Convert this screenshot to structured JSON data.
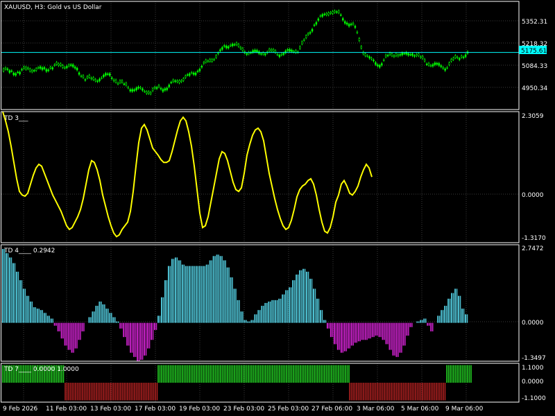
{
  "chart_data": [
    {
      "type": "candlestick",
      "title": "XAUUSD, H3:  Gold vs US Dollar",
      "yticks": [
        "5352.31",
        "5218.32",
        "5084.33",
        "4950.34"
      ],
      "current_price": "5175.61",
      "ylim": [
        4880,
        5440
      ],
      "close_approx": [
        5080,
        5075,
        5090,
        5085,
        5095,
        5100,
        5105,
        5110,
        5090,
        5040,
        5030,
        5050,
        5060,
        5020,
        5000,
        4990,
        4980,
        4970,
        4990,
        5000,
        5020,
        5040,
        5060,
        5100,
        5120,
        5160,
        5200,
        5230,
        5185,
        5180,
        5175,
        5180,
        5170,
        5175,
        5180,
        5190,
        5240,
        5330,
        5360,
        5390,
        5370,
        5340,
        5300,
        5180,
        5130,
        5120,
        5150,
        5170,
        5160,
        5180,
        5140,
        5120,
        5110,
        5100,
        5130,
        5160,
        5175
      ],
      "colors": {
        "up": "#00ff00",
        "price_line": "#00ffff"
      }
    },
    {
      "type": "line",
      "title": "TD 3___",
      "yticks": [
        "2.3059",
        "0.0000",
        "-1.3170"
      ],
      "ylim": [
        -1.317,
        2.3059
      ],
      "x": [
        0,
        4,
        8,
        12,
        16,
        20,
        24,
        28,
        32,
        36,
        40,
        44,
        48,
        52,
        56,
        60,
        64,
        68,
        72,
        76,
        80,
        84,
        88,
        92,
        96,
        100,
        104,
        108,
        112,
        116,
        120,
        124,
        128,
        132,
        136,
        140,
        144,
        148,
        152,
        156,
        160,
        164,
        168,
        172,
        176,
        180,
        184,
        188,
        192,
        196,
        200,
        204,
        208,
        212,
        216,
        220,
        224,
        228,
        232,
        236,
        240,
        244,
        248,
        252,
        256,
        260,
        264,
        268,
        272,
        276,
        280,
        284,
        288,
        292,
        296,
        300,
        304,
        308,
        312,
        316,
        320,
        324,
        328,
        332,
        336,
        340,
        344,
        348,
        352,
        356,
        360,
        364,
        368,
        372,
        376,
        380,
        384,
        388,
        392,
        396,
        400,
        404,
        408,
        412,
        416,
        420,
        424,
        428,
        432,
        436,
        440,
        444,
        448,
        452,
        456,
        460,
        464,
        468,
        472,
        476,
        480,
        484,
        488,
        492,
        496,
        500,
        504,
        508,
        512,
        516,
        520,
        524,
        528,
        532,
        536,
        540,
        544,
        548,
        552,
        556,
        560,
        564,
        568,
        572,
        576,
        580,
        584,
        588,
        592,
        596,
        600,
        604,
        608,
        612,
        616,
        620,
        624,
        628,
        632,
        636,
        640,
        644,
        648,
        652,
        656,
        660,
        664,
        668,
        672,
        674
      ],
      "y": [
        2.3,
        2.05,
        1.75,
        1.35,
        0.9,
        0.45,
        0.1,
        0.0,
        -0.03,
        0.05,
        0.3,
        0.55,
        0.75,
        0.85,
        0.8,
        0.6,
        0.4,
        0.2,
        0.0,
        -0.15,
        -0.3,
        -0.45,
        -0.65,
        -0.85,
        -0.95,
        -0.9,
        -0.75,
        -0.6,
        -0.4,
        -0.1,
        0.3,
        0.7,
        0.95,
        0.9,
        0.7,
        0.4,
        0.0,
        -0.3,
        -0.6,
        -0.85,
        -1.05,
        -1.15,
        -1.1,
        -0.95,
        -0.85,
        -0.75,
        -0.45,
        0.1,
        0.8,
        1.45,
        1.85,
        1.95,
        1.8,
        1.55,
        1.3,
        1.2,
        1.1,
        0.98,
        0.9,
        0.9,
        0.95,
        1.2,
        1.5,
        1.8,
        2.05,
        2.15,
        2.05,
        1.75,
        1.35,
        0.8,
        0.15,
        -0.5,
        -0.9,
        -0.85,
        -0.6,
        -0.2,
        0.2,
        0.6,
        1.0,
        1.2,
        1.15,
        0.95,
        0.65,
        0.35,
        0.15,
        0.1,
        0.2,
        0.6,
        1.1,
        1.4,
        1.65,
        1.8,
        1.85,
        1.75,
        1.5,
        1.05,
        0.6,
        0.25,
        -0.1,
        -0.4,
        -0.65,
        -0.85,
        -0.95,
        -0.9,
        -0.7,
        -0.4,
        -0.05,
        0.15,
        0.25,
        0.3,
        0.4,
        0.45,
        0.3,
        0.0,
        -0.4,
        -0.75,
        -1.0,
        -1.05,
        -0.9,
        -0.6,
        -0.2,
        0.0,
        0.3,
        0.4,
        0.25,
        0.05,
        0.0,
        0.1,
        0.25,
        0.5,
        0.7,
        0.85,
        0.75,
        0.5
      ],
      "colors": {
        "line": "#ffff00"
      }
    },
    {
      "type": "histogram",
      "title": "TD 4____ 0.2942",
      "yticks": [
        "2.7472",
        "0.0000",
        "-1.3497"
      ],
      "ylim": [
        -1.3497,
        2.7472
      ],
      "values": [
        2.6,
        2.45,
        2.3,
        2.1,
        1.8,
        1.5,
        1.2,
        0.95,
        0.75,
        0.55,
        0.5,
        0.45,
        0.35,
        0.25,
        0.15,
        -0.1,
        -0.3,
        -0.55,
        -0.8,
        -0.95,
        -1.05,
        -0.9,
        -0.6,
        -0.3,
        0.0,
        0.2,
        0.4,
        0.6,
        0.75,
        0.65,
        0.5,
        0.35,
        0.2,
        0.05,
        -0.2,
        -0.5,
        -0.8,
        -1.05,
        -1.2,
        -1.35,
        -1.3,
        -1.15,
        -0.9,
        -0.6,
        -0.25,
        0.25,
        0.9,
        1.5,
        2.0,
        2.25,
        2.3,
        2.2,
        2.05,
        2.0,
        2.0,
        2.0,
        2.0,
        2.0,
        2.0,
        2.05,
        2.2,
        2.35,
        2.4,
        2.35,
        2.2,
        1.95,
        1.6,
        1.2,
        0.8,
        0.4,
        0.1,
        0.05,
        0.1,
        0.3,
        0.45,
        0.6,
        0.7,
        0.75,
        0.8,
        0.8,
        0.85,
        1.0,
        1.15,
        1.25,
        1.5,
        1.7,
        1.85,
        1.9,
        1.8,
        1.55,
        1.2,
        0.85,
        0.45,
        0.1,
        -0.2,
        -0.5,
        -0.75,
        -0.95,
        -1.05,
        -1.0,
        -0.9,
        -0.8,
        -0.7,
        -0.65,
        -0.6,
        -0.6,
        -0.55,
        -0.5,
        -0.45,
        -0.5,
        -0.6,
        -0.75,
        -0.95,
        -1.15,
        -1.2,
        -1.05,
        -0.8,
        -0.45,
        -0.15,
        0.0,
        0.05,
        0.1,
        0.15,
        -0.1,
        -0.3,
        0.0,
        0.25,
        0.45,
        0.6,
        0.85,
        1.05,
        1.2,
        0.95,
        0.5,
        0.3
      ],
      "colors": {
        "positive": "#4fc4d6",
        "negative": "#cc22cc"
      }
    },
    {
      "type": "histogram",
      "title": "TD 7____ 0.0000 1.0000",
      "yticks": [
        "1.1000",
        "0.0000",
        "-1.1000"
      ],
      "ylim": [
        -1.1,
        1.1
      ],
      "segments": [
        {
          "from": 0,
          "to": 90,
          "value": 1,
          "color": "#22cc22"
        },
        {
          "from": 90,
          "to": 224,
          "value": -1,
          "color": "#b02020"
        },
        {
          "from": 224,
          "to": 500,
          "value": 1,
          "color": "#22cc22"
        },
        {
          "from": 500,
          "to": 640,
          "value": -1,
          "color": "#b02020"
        },
        {
          "from": 640,
          "to": 676,
          "value": 1,
          "color": "#22cc22"
        }
      ]
    }
  ],
  "x_axis_labels": [
    "9 Feb 2026",
    "11 Feb 03:00",
    "13 Feb 03:00",
    "17 Feb 03:00",
    "19 Feb 03:00",
    "23 Feb 03:00",
    "25 Feb 03:00",
    "27 Feb 06:00",
    "3 Mar 06:00",
    "5 Mar 06:00",
    "9 Mar 06:00"
  ],
  "theme": {
    "background": "#000000",
    "grid": "#3c3c3c",
    "text": "#ffffff",
    "border": "#ffffff"
  }
}
